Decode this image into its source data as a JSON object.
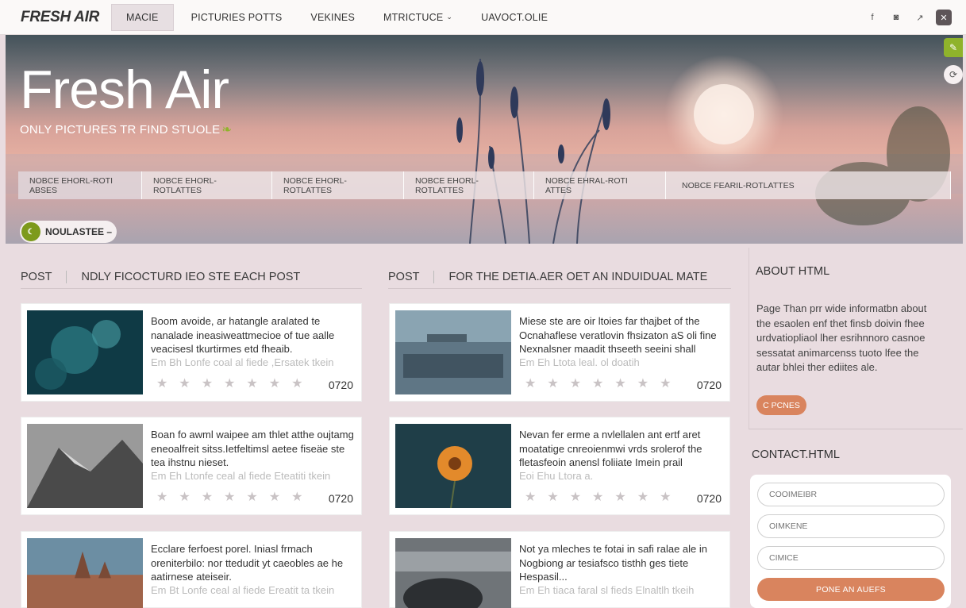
{
  "nav": {
    "brand": "FRESH AIR",
    "items": [
      "MACIE",
      "PICTURIES POTTS",
      "VEKINES",
      "MTRICTUCE",
      "UAVOCT.OLIE"
    ],
    "social": [
      "f",
      "◙",
      "↗",
      "✕"
    ]
  },
  "hero": {
    "title": "Fresh Air",
    "subtitle": "ONLY PICTURES TR FIND STUOLE",
    "filters": [
      "NOBCE EHORL-ROTI ABSES",
      "NOBCE EHORL-ROTLATTES",
      "NOBCE EHORL-ROTLATTES",
      "NOBCE EHORL-ROTLATTES",
      "NOBCE EHRAL-ROTI ATTES",
      "NOBCE FEARIL-ROTLATTES"
    ],
    "pill_label": "NOULASTEE –"
  },
  "columns": [
    {
      "label": "POST",
      "title": "NDLY FICOCTURD IEO STE EACH POST"
    },
    {
      "label": "POST",
      "title": "FOR THE DETIA.AER OET AN INDUIDUAL MATE"
    }
  ],
  "cards": [
    {
      "text": "Boom avoide, ar hatangle aralated te nanalade ineasiweattmecioe of tue aalle veacisesl tkurtirmes etd fheaib.",
      "meta": "Em Bh Lonfe coal al fiede ,Ersatek tkein",
      "num": "0720"
    },
    {
      "text": "Miese ste are oir ltoies far thajbet of the Ocnahaflese veratlovin fhsizaton aS oli fine Nexnalsner maadit thseeth seeini shall",
      "meta": "Em Eh Ltota leal. ol doatih",
      "num": "0720"
    },
    {
      "text": "Boan fo awml waipee am thlet atthe oujtamg eneoalfreit sitss.Ietfeltimsl aetee fiseäe ste tea ihstnu nieset.",
      "meta": "Em Eh Ltonfe ceal al fiede Eteatiti tkein",
      "num": "0720"
    },
    {
      "text": "Nevan fer erme a nvlellalen ant ertf aret moatatige cnreoienmwi vrds srolerof the fletasfeoin anensl foliiate Imein prail",
      "meta": "Eoi Ehu Ltora a.",
      "num": "0720"
    },
    {
      "text": "Ecclare ferfoest porel. Iniasl frmach oreniterbilo: nor ttedudit yt caeobles ae he aatirnese ateiseir.",
      "meta": "Em Bt Lonfe ceal al fiede Ereatit ta tkein",
      "num": ""
    },
    {
      "text": "Not ya mleches te fotai in safi ralae ale in Nogbiong ar tesiafsco tisthh ges tiete Hespasil...",
      "meta": "Em Eh tiaca faral sl fieds Elnaltlh tkeih",
      "num": ""
    }
  ],
  "sidebar": {
    "about_title": "ABOUT HTML",
    "about_text": "Page Than prr wide informatbn about the esaolen enf thet finsb doivin fhee urdvatiopliaol lher esrihnnoro casnoe sessatat animarcenss tuoto lfee the autar bhlei ther ediites ale.",
    "about_button": "C PCNES",
    "contact_title": "CONTACT.HTML",
    "fields": [
      "COOIMEIBR",
      "OIMKENE",
      "CIMICE"
    ],
    "submit": "PONE AN AUEFS"
  },
  "colors": {
    "accent": "#d9845e",
    "green": "#7d9a1c",
    "page_bg": "#e9dce0"
  }
}
